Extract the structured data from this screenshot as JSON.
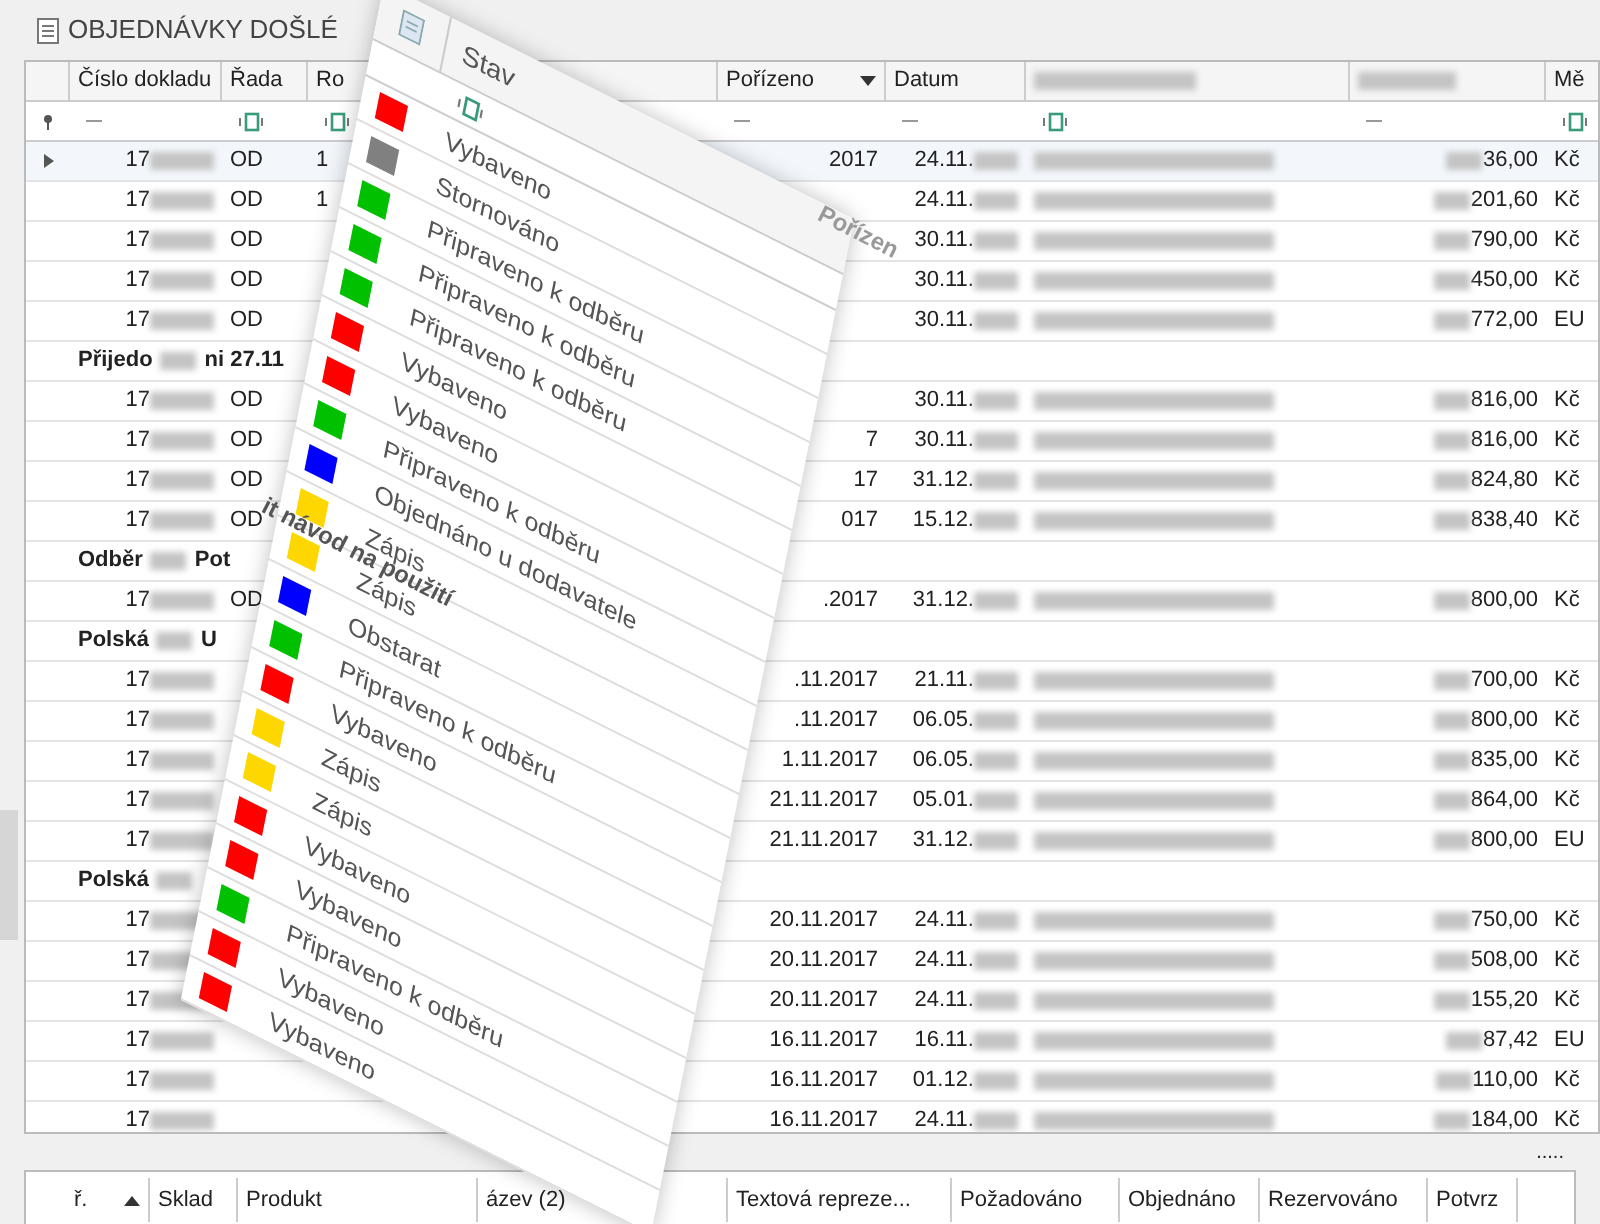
{
  "title": "OBJEDNÁVKY DOŠLÉ",
  "columns": [
    {
      "label": "Číslo dokladu",
      "kind": "text"
    },
    {
      "label": "Řada",
      "kind": "text"
    },
    {
      "label": "Ro",
      "kind": "text"
    },
    {
      "label": "Pořízeno",
      "kind": "sort"
    },
    {
      "label": "Datum",
      "kind": "text"
    },
    {
      "kind": "blurred"
    },
    {
      "kind": "blurred"
    },
    {
      "label": "Mě",
      "kind": "text"
    }
  ],
  "rows": [
    {
      "kind": "row",
      "number": "17",
      "series": "OD",
      "col3": "1",
      "created": "2017",
      "date": "24.11.",
      "amount": "36,00",
      "currency": "Kč",
      "selected": true
    },
    {
      "kind": "row",
      "number": "17",
      "series": "OD",
      "col3": "1",
      "created": "",
      "date": "24.11.",
      "amount": "201,60",
      "currency": "Kč",
      "selected": false
    },
    {
      "kind": "row",
      "number": "17",
      "series": "OD",
      "col3": "",
      "created": "",
      "date": "30.11.",
      "amount": "790,00",
      "currency": "Kč",
      "selected": false
    },
    {
      "kind": "row",
      "number": "17",
      "series": "OD",
      "col3": "",
      "created": "",
      "date": "30.11.",
      "amount": "450,00",
      "currency": "Kč",
      "selected": false
    },
    {
      "kind": "row",
      "number": "17",
      "series": "OD",
      "col3": "",
      "created": "",
      "date": "30.11.",
      "amount": "772,00",
      "currency": "EU",
      "selected": false
    },
    {
      "kind": "group",
      "start": "Přijedo",
      "end": "ni 27.11"
    },
    {
      "kind": "row",
      "number": "17",
      "series": "OD",
      "col3": "",
      "created": "",
      "date": "30.11.",
      "amount": "816,00",
      "currency": "Kč",
      "selected": false
    },
    {
      "kind": "row",
      "number": "17",
      "series": "OD",
      "col3": "",
      "created": "7",
      "date": "30.11.",
      "amount": "816,00",
      "currency": "Kč",
      "selected": false
    },
    {
      "kind": "row",
      "number": "17",
      "series": "OD",
      "col3": "",
      "created": "17",
      "date": "31.12.",
      "amount": "824,80",
      "currency": "Kč",
      "selected": false
    },
    {
      "kind": "row",
      "number": "17",
      "series": "OD",
      "col3": "",
      "created": "017",
      "date": "15.12.",
      "amount": "838,40",
      "currency": "Kč",
      "selected": false
    },
    {
      "kind": "group",
      "start": "Odběr",
      "end": "Pot"
    },
    {
      "kind": "row",
      "number": "17",
      "series": "OD",
      "col3": "",
      "created": ".2017",
      "date": "31.12.",
      "amount": "800,00",
      "currency": "Kč",
      "selected": false
    },
    {
      "kind": "group",
      "start": "Polská",
      "end": "U"
    },
    {
      "kind": "row",
      "number": "17",
      "series": "",
      "col3": "",
      "created": ".11.2017",
      "date": "21.11.",
      "amount": "700,00",
      "currency": "Kč",
      "selected": false
    },
    {
      "kind": "row",
      "number": "17",
      "series": "",
      "col3": "",
      "created": ".11.2017",
      "date": "06.05.",
      "amount": "800,00",
      "currency": "Kč",
      "selected": false
    },
    {
      "kind": "row",
      "number": "17",
      "series": "",
      "col3": "",
      "created": "1.11.2017",
      "date": "06.05.",
      "amount": "835,00",
      "currency": "Kč",
      "selected": false
    },
    {
      "kind": "row",
      "number": "17",
      "series": "",
      "col3": "",
      "created": "21.11.2017",
      "date": "05.01.",
      "amount": "864,00",
      "currency": "Kč",
      "selected": false
    },
    {
      "kind": "row",
      "number": "17",
      "series": "",
      "col3": "",
      "created": "21.11.2017",
      "date": "31.12.",
      "amount": "800,00",
      "currency": "EU",
      "selected": false
    },
    {
      "kind": "group",
      "start": "Polská",
      "end": ""
    },
    {
      "kind": "row",
      "number": "17",
      "series": "",
      "col3": "",
      "created": "20.11.2017",
      "date": "24.11.",
      "amount": "750,00",
      "currency": "Kč",
      "selected": false
    },
    {
      "kind": "row",
      "number": "17",
      "series": "",
      "col3": "",
      "created": "20.11.2017",
      "date": "24.11.",
      "amount": "508,00",
      "currency": "Kč",
      "selected": false
    },
    {
      "kind": "row",
      "number": "17",
      "series": "",
      "col3": "",
      "created": "20.11.2017",
      "date": "24.11.",
      "amount": "155,20",
      "currency": "Kč",
      "selected": false
    },
    {
      "kind": "row",
      "number": "17",
      "series": "",
      "col3": "",
      "created": "16.11.2017",
      "date": "16.11.",
      "amount": "87,42",
      "currency": "EU",
      "selected": false
    },
    {
      "kind": "row",
      "number": "17",
      "series": "",
      "col3": "",
      "created": "16.11.2017",
      "date": "01.12.",
      "amount": "110,00",
      "currency": "Kč",
      "selected": false
    },
    {
      "kind": "row",
      "number": "17",
      "series": "",
      "col3": "",
      "created": "16.11.2017",
      "date": "24.11.",
      "amount": "184,00",
      "currency": "Kč",
      "selected": false
    }
  ],
  "overlay": {
    "header": "Stav",
    "side_header": "Pořízen",
    "fragment": "it návod na použití",
    "items": [
      {
        "label": "Vybaveno",
        "color": "#ff0000"
      },
      {
        "label": "Stornováno",
        "color": "#808080"
      },
      {
        "label": "Připraveno k odběru",
        "color": "#00c000"
      },
      {
        "label": "Připraveno k odběru",
        "color": "#00c000"
      },
      {
        "label": "Připraveno k odběru",
        "color": "#00c000"
      },
      {
        "label": "Vybaveno",
        "color": "#ff0000"
      },
      {
        "label": "Vybaveno",
        "color": "#ff0000"
      },
      {
        "label": "Připraveno k odběru",
        "color": "#00c000"
      },
      {
        "label": "Objednáno u dodavatele",
        "color": "#0000ff"
      },
      {
        "label": "Zápis",
        "color": "#ffd700"
      },
      {
        "label": "Zápis",
        "color": "#ffd700"
      },
      {
        "label": "Obstarat",
        "color": "#0000ff"
      },
      {
        "label": "Připraveno k odběru",
        "color": "#00c000"
      },
      {
        "label": "Vybaveno",
        "color": "#ff0000"
      },
      {
        "label": "Zápis",
        "color": "#ffd700"
      },
      {
        "label": "Zápis",
        "color": "#ffd700"
      },
      {
        "label": "Vybaveno",
        "color": "#ff0000"
      },
      {
        "label": "Vybaveno",
        "color": "#ff0000"
      },
      {
        "label": "Připraveno k odběru",
        "color": "#00c000"
      },
      {
        "label": "Vybaveno",
        "color": "#ff0000"
      },
      {
        "label": "Vybaveno",
        "color": "#ff0000"
      }
    ]
  },
  "bottom": {
    "more": ".....",
    "columns": [
      {
        "label": "ř.",
        "kind": "sort"
      },
      {
        "label": "Sklad",
        "kind": "text"
      },
      {
        "label": "Produkt",
        "kind": "text"
      },
      {
        "label": "ázev (2)",
        "kind": "text"
      },
      {
        "label": "Textová repreze...",
        "kind": "text"
      },
      {
        "label": "Požadováno",
        "kind": "text"
      },
      {
        "label": "Objednáno",
        "kind": "text"
      },
      {
        "label": "Rezervováno",
        "kind": "text"
      },
      {
        "label": "Potvrz",
        "kind": "text"
      }
    ]
  }
}
